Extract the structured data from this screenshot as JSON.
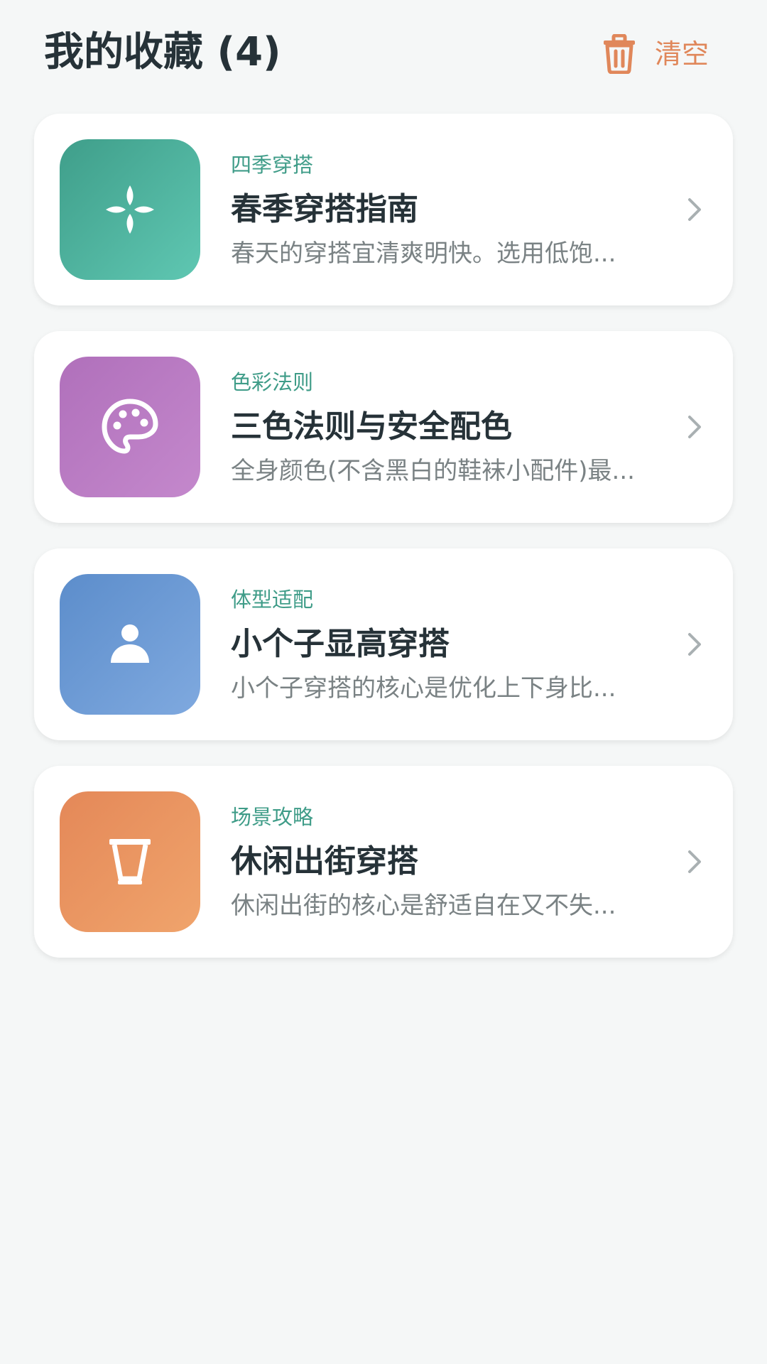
{
  "header": {
    "title": "我的收藏 (4)",
    "clear_label": "清空",
    "clear_icon": "trash-icon",
    "accent_color": "#e0875a"
  },
  "favorites": [
    {
      "category": "四季穿搭",
      "title": "春季穿搭指南",
      "excerpt": "春天的穿搭宜清爽明快。选用低饱...",
      "icon": "flower-icon",
      "gradient": [
        "#3f9e8a",
        "#5fc7b2"
      ]
    },
    {
      "category": "色彩法则",
      "title": "三色法则与安全配色",
      "excerpt": "全身颜色(不含黑白的鞋袜小配件)最...",
      "icon": "palette-icon",
      "gradient": [
        "#b070bb",
        "#c488cc"
      ]
    },
    {
      "category": "体型适配",
      "title": "小个子显高穿搭",
      "excerpt": "小个子穿搭的核心是优化上下身比...",
      "icon": "person-icon",
      "gradient": [
        "#5c8dcb",
        "#7fa9df"
      ]
    },
    {
      "category": "场景攻略",
      "title": "休闲出街穿搭",
      "excerpt": "休闲出街的核心是舒适自在又不失...",
      "icon": "cup-icon",
      "gradient": [
        "#e48858",
        "#f0a46c"
      ]
    }
  ]
}
